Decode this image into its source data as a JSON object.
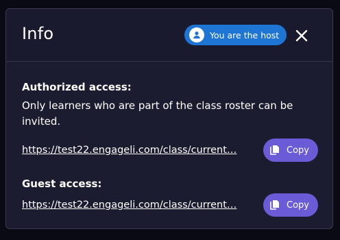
{
  "dialog": {
    "title": "Info",
    "host_badge": {
      "label": "You are the host",
      "icon": "person-icon",
      "color": "#1e75d4"
    },
    "close_icon": "close-icon"
  },
  "authorized": {
    "label": "Authorized access:",
    "description": "Only learners who are part of the class roster can be invited.",
    "link": "https://test22.engageli.com/class/current…",
    "copy_label": "Copy"
  },
  "guest": {
    "label": "Guest access:",
    "link": "https://test22.engageli.com/class/current…",
    "copy_label": "Copy"
  },
  "colors": {
    "accent": "#6a5cd6",
    "panel": "#1c1c30",
    "header": "#1a1a2e"
  }
}
